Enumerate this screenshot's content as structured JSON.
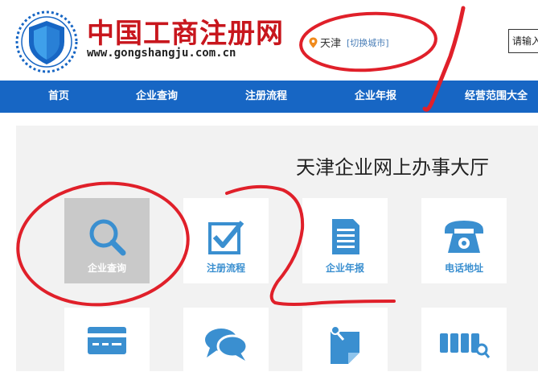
{
  "header": {
    "site_name": "中国工商注册网",
    "site_url": "www.gongshangju.com.cn",
    "city": {
      "name": "天津",
      "switch_label": "[切换城市]"
    },
    "search": {
      "placeholder": "请输入"
    }
  },
  "nav": {
    "items": [
      "首页",
      "企业查询",
      "注册流程",
      "企业年报",
      "经营范围大全"
    ]
  },
  "main": {
    "title": "天津企业网上办事大厅",
    "tiles": [
      {
        "label": "企业查询",
        "icon": "search-icon",
        "active": true
      },
      {
        "label": "注册流程",
        "icon": "checkbox-icon",
        "active": false
      },
      {
        "label": "企业年报",
        "icon": "document-icon",
        "active": false
      },
      {
        "label": "电话地址",
        "icon": "telephone-icon",
        "active": false
      },
      {
        "label": "",
        "icon": "card-icon",
        "active": false
      },
      {
        "label": "",
        "icon": "chat-icon",
        "active": false
      },
      {
        "label": "",
        "icon": "sticky-note-icon",
        "active": false
      },
      {
        "label": "",
        "icon": "barcode-search-icon",
        "active": false
      }
    ]
  },
  "colors": {
    "brand_red": "#c8161d",
    "nav_blue": "#1766c4",
    "icon_blue": "#3a8fd0",
    "annotation_red": "#e0202a"
  }
}
